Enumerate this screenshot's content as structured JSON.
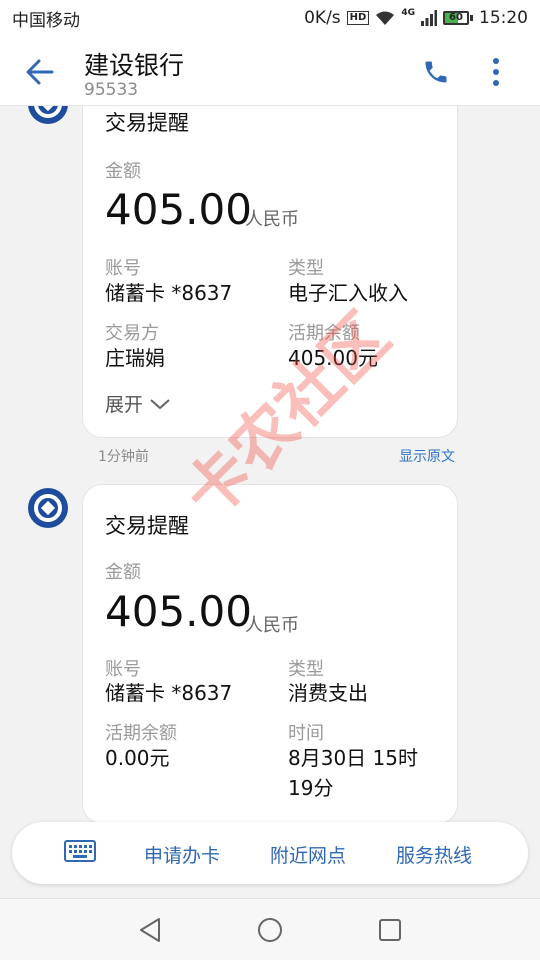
{
  "status_bar": {
    "carrier": "中国移动",
    "speed": "0K/s",
    "hd_badge": "HD",
    "network_badge": "4G",
    "battery_percent": 60,
    "battery_text": "60",
    "time": "15:20"
  },
  "header": {
    "title": "建设银行",
    "subtitle": "95533",
    "back_icon": "arrow-left-icon",
    "call_icon": "phone-icon",
    "more_icon": "more-vertical-icon"
  },
  "messages": [
    {
      "title": "交易提醒",
      "amount_label": "金额",
      "amount": "405.00",
      "currency": "人民币",
      "fields": [
        {
          "label": "账号",
          "value": "储蓄卡 *8637"
        },
        {
          "label": "类型",
          "value": "电子汇入收入"
        },
        {
          "label": "交易方",
          "value": "庄瑞娟"
        },
        {
          "label": "活期余额",
          "value": "405.00元"
        }
      ],
      "expand_label": "展开",
      "time_ago": "1分钟前",
      "show_original": "显示原文"
    },
    {
      "title": "交易提醒",
      "amount_label": "金额",
      "amount": "405.00",
      "currency": "人民币",
      "fields": [
        {
          "label": "账号",
          "value": "储蓄卡 *8637"
        },
        {
          "label": "类型",
          "value": "消费支出"
        },
        {
          "label": "活期余额",
          "value": "0.00元"
        },
        {
          "label": "时间",
          "value_line1": "8月30日 15时",
          "value_line2": "19分"
        }
      ]
    }
  ],
  "watermark": "卡农社区",
  "bottom_menu": {
    "keyboard_icon": "keyboard-icon",
    "items": [
      "申请办卡",
      "附近网点",
      "服务热线"
    ]
  },
  "nav_bar": {
    "icons": [
      "back-triangle-icon",
      "home-circle-icon",
      "recent-square-icon"
    ]
  },
  "colors": {
    "accent_blue": "#2f68b4",
    "bank_blue": "#1f4c9c",
    "link_blue": "#2f74c8",
    "watermark_red": "#f0463c"
  }
}
